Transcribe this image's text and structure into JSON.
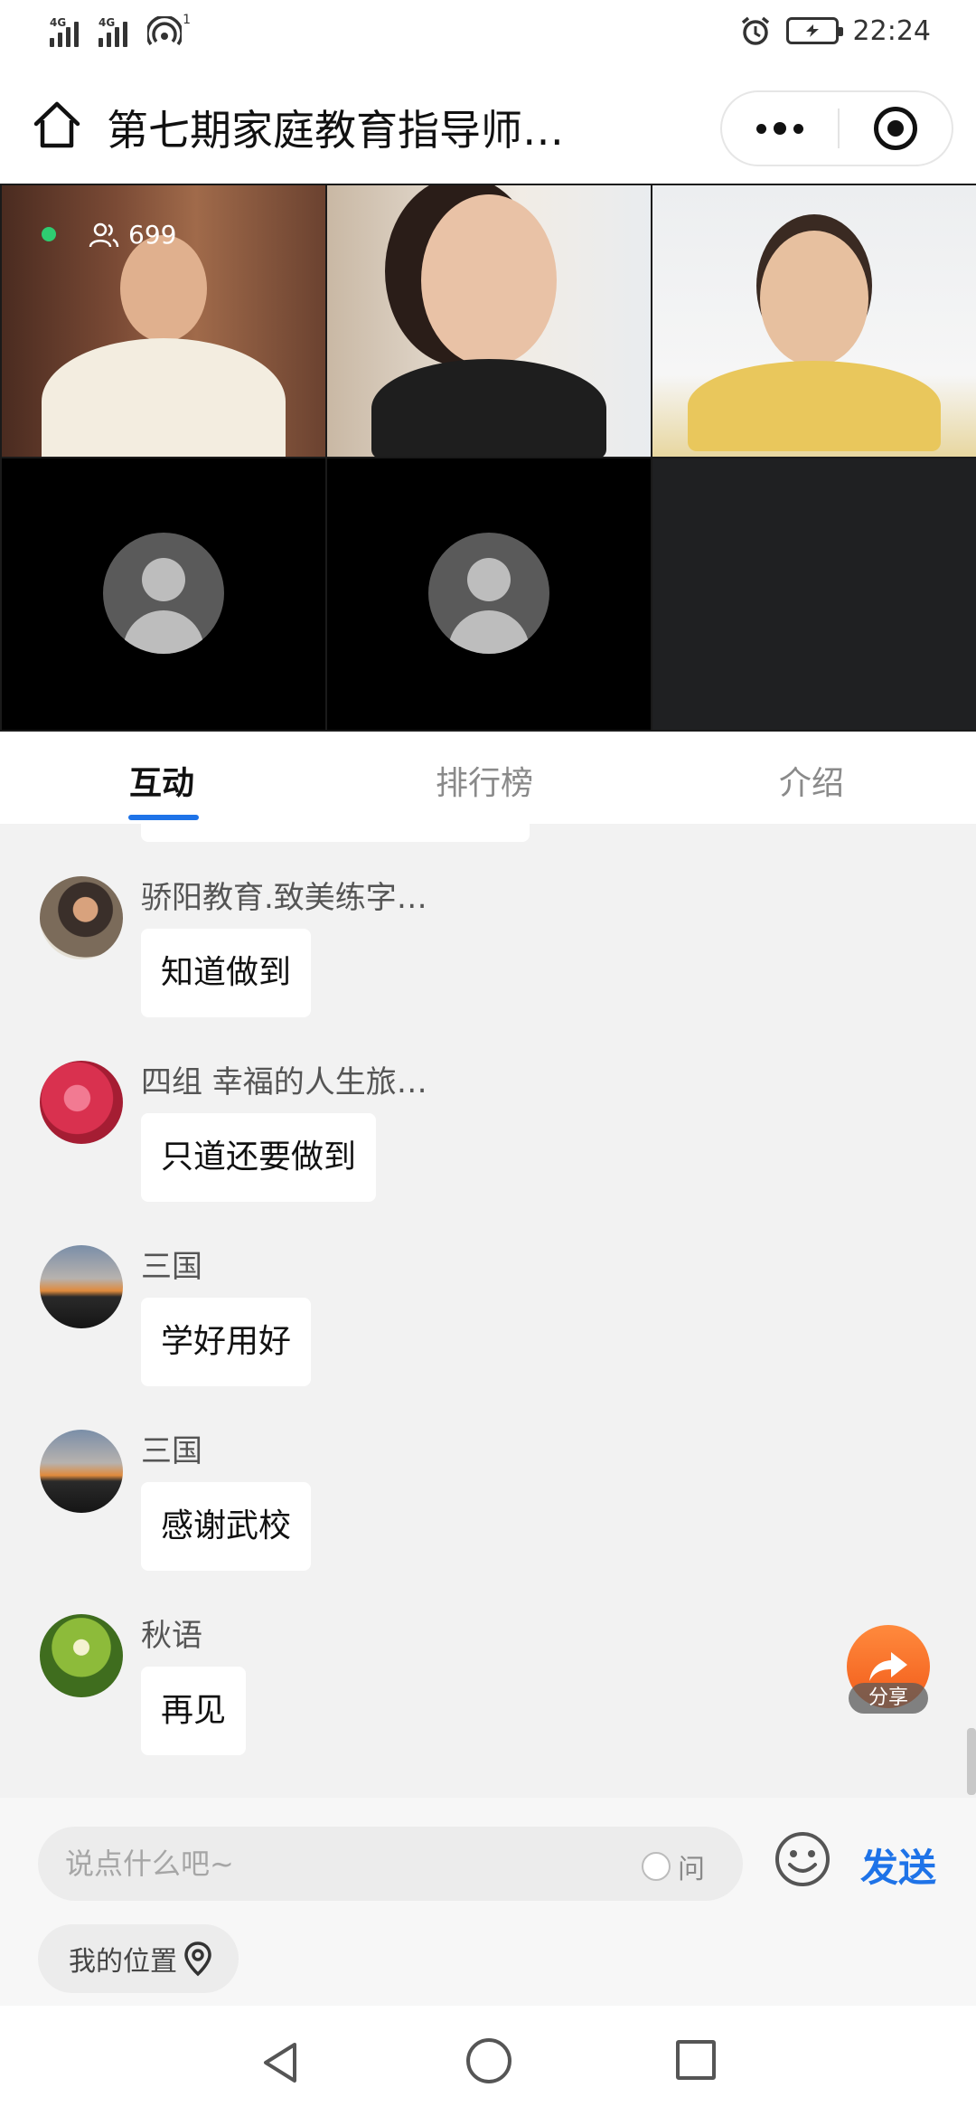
{
  "status_bar": {
    "network_1": "4G",
    "network_2": "4G",
    "hotspot_count": "1",
    "time": "22:24"
  },
  "header": {
    "title": "第七期家庭教育指导师…"
  },
  "video": {
    "viewer_count": "699",
    "live_color": "#2ecc71"
  },
  "tabs": [
    {
      "label": "互动",
      "active": true
    },
    {
      "label": "排行榜",
      "active": false
    },
    {
      "label": "介绍",
      "active": false
    }
  ],
  "messages": [
    {
      "name": "骄阳教育.致美练字…",
      "text": "知道做到",
      "avatar": "man-photo"
    },
    {
      "name": "四组 幸福的人生旅…",
      "text": "只道还要做到",
      "avatar": "red-flower"
    },
    {
      "name": "三国",
      "text": "学好用好",
      "avatar": "sunset-sky"
    },
    {
      "name": "三国",
      "text": "感谢武校",
      "avatar": "sunset-sky"
    },
    {
      "name": "秋语",
      "text": "再见",
      "avatar": "green-dandelion"
    }
  ],
  "share": {
    "label": "分享"
  },
  "input": {
    "placeholder": "说点什么吧~",
    "value": "",
    "ask_label": "问",
    "send_label": "发送",
    "location_label": "我的位置"
  },
  "colors": {
    "accent": "#1e73e8",
    "share": "#f25b1a"
  }
}
